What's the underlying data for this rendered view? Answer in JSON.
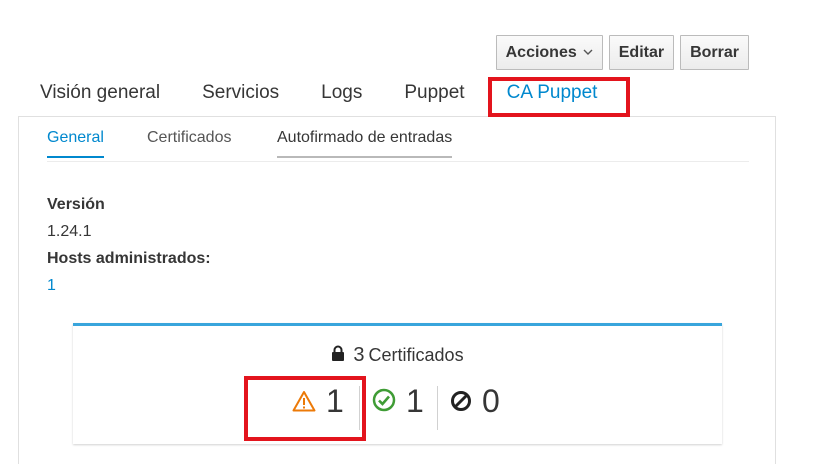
{
  "toolbar": {
    "actions_label": "Acciones",
    "edit_label": "Editar",
    "delete_label": "Borrar"
  },
  "tabs": [
    {
      "label": "Visión general"
    },
    {
      "label": "Servicios"
    },
    {
      "label": "Logs"
    },
    {
      "label": "Puppet"
    },
    {
      "label": "CA Puppet",
      "active": true
    }
  ],
  "subtabs": [
    {
      "label": "General",
      "active": true
    },
    {
      "label": "Certificados"
    },
    {
      "label": "Autofirmado de entradas"
    }
  ],
  "properties": {
    "version_label": "Versión",
    "version_value": "1.24.1",
    "hosts_label": "Hosts administrados:",
    "hosts_value": "1"
  },
  "certificates": {
    "total": "3",
    "title": "Certificados",
    "pending": "1",
    "signed": "1",
    "revoked": "0"
  },
  "colors": {
    "accent": "#0088ce",
    "card_border": "#39a5dc",
    "warning": "#ec7a08",
    "success": "#3f9c35",
    "highlight": "#e3141d"
  },
  "icons": [
    "chevron-down-icon",
    "lock-icon",
    "warning-triangle-icon",
    "check-circle-icon",
    "ban-icon"
  ]
}
